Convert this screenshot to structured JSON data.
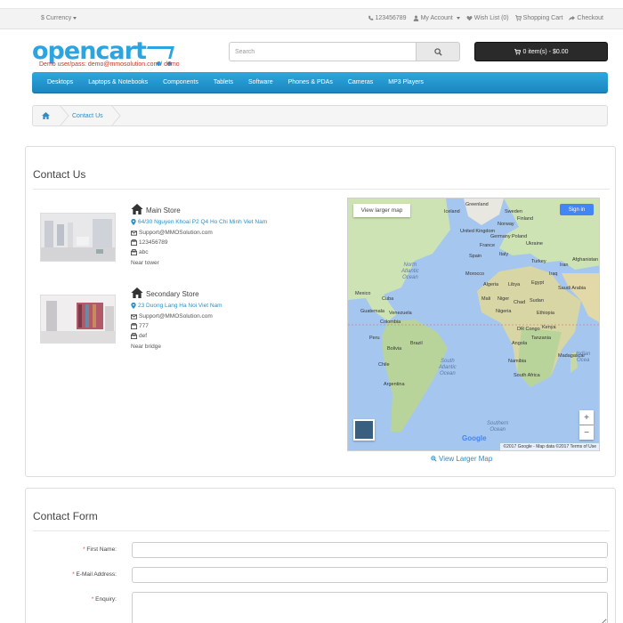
{
  "topbar": {
    "currency": "$ Currency",
    "phone": "123456789",
    "account": "My Account",
    "wishlist": "Wish List (0)",
    "cart": "Shopping Cart",
    "checkout": "Checkout"
  },
  "header": {
    "logo_text": "opencart",
    "demo_note": "Demo user/pass: demo@mmosolution.com / demo",
    "search_placeholder": "Search",
    "cart_button": "0 item(s) - $0.00"
  },
  "menu": [
    "Desktops",
    "Laptops & Notebooks",
    "Components",
    "Tablets",
    "Software",
    "Phones & PDAs",
    "Cameras",
    "MP3 Players"
  ],
  "breadcrumb": {
    "current": "Contact Us"
  },
  "contact": {
    "title": "Contact Us",
    "stores": [
      {
        "name": "Main Store",
        "address": "64/30 Nguyen Khoai P2 Q4 Ho Chi Minh Viet Nam",
        "email": "Support@MMOSolution.com",
        "phone": "123456789",
        "fax": "abc",
        "note": "Near tower"
      },
      {
        "name": "Secondary Store",
        "address": "23 Duong Lang Ha Noi Viet Nam",
        "email": "Support@MMOSolution.com",
        "phone": "777",
        "fax": "def",
        "note": "Near bridge"
      }
    ],
    "map": {
      "view_larger_button": "View larger map",
      "signin": "Sign in",
      "zoom_in": "+",
      "zoom_out": "−",
      "google": "Google",
      "attribution": "©2017 Google - Map data ©2017   Terms of Use",
      "labels": {
        "greenland": "Greenland",
        "iceland": "Iceland",
        "sweden": "Sweden",
        "finland": "Finland",
        "norway": "Norway",
        "uk": "United Kingdom",
        "poland": "Poland",
        "ukraine": "Ukraine",
        "germany": "Germany",
        "france": "France",
        "spain": "Spain",
        "italy": "Italy",
        "turkey": "Turkey",
        "iraq": "Iraq",
        "iran": "Iran",
        "afghanistan": "Afghanistan",
        "morocco": "Morocco",
        "algeria": "Algeria",
        "libya": "Libya",
        "egypt": "Egypt",
        "saudi": "Saudi Arabia",
        "mali": "Mali",
        "niger": "Niger",
        "chad": "Chad",
        "sudan": "Sudan",
        "nigeria": "Nigeria",
        "ethiopia": "Ethiopia",
        "kenya": "Kenya",
        "drc": "DR Congo",
        "tanzania": "Tanzania",
        "angola": "Angola",
        "namibia": "Namibia",
        "madagascar": "Madagascar",
        "south_africa": "South Africa",
        "mexico": "Mexico",
        "cuba": "Cuba",
        "guatemala": "Guatemala",
        "venezuela": "Venezuela",
        "colombia": "Colombia",
        "peru": "Peru",
        "brazil": "Brazil",
        "bolivia": "Bolivia",
        "chile": "Chile",
        "argentina": "Argentina"
      },
      "oceans": {
        "north_atlantic": "North\nAtlantic\nOcean",
        "south_atlantic": "South\nAtlantic\nOcean",
        "indian": "Indian\nOcea",
        "southern": "Southern\nOcean"
      }
    },
    "view_larger_map_link": "View Larger Map"
  },
  "form": {
    "title": "Contact Form",
    "first_name": "First Name:",
    "email": "E-Mail Address:",
    "enquiry": "Enquiry:",
    "required_mark": "*"
  },
  "colors": {
    "brand_blue": "#2ba4e0",
    "link_blue": "#2a8fc9",
    "menu_blue": "#229ad4",
    "required_red": "#e74c3c"
  }
}
